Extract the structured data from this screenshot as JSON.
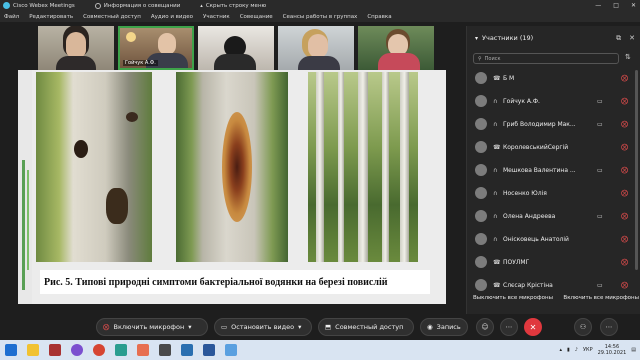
{
  "window": {
    "app_title": "Cisco Webex Meetings",
    "info_label": "Информация о совещании",
    "hide_menu_label": "Скрыть строку меню",
    "controls": [
      "—",
      "□",
      "✕"
    ]
  },
  "menu": [
    "Файл",
    "Редактировать",
    "Совместный доступ",
    "Аудио и видео",
    "Участник",
    "Совещание",
    "Сеансы работы в группах",
    "Справка"
  ],
  "video_tiles": [
    {
      "label": ""
    },
    {
      "label": "Гойчук А.Ф."
    },
    {
      "label": ""
    },
    {
      "label": ""
    },
    {
      "label": ""
    }
  ],
  "slide": {
    "caption": "Рис. 5. Типові природні симптоми бактеріальної водянки на березі повислій"
  },
  "participants": {
    "title": "Участники (19)",
    "search_placeholder": "Поиск",
    "items": [
      {
        "name": "Б М",
        "device": "phone"
      },
      {
        "name": "Гойчук А.Ф.",
        "device": "headset",
        "cam": true
      },
      {
        "name": "Гриб Володимир Мак...",
        "device": "headset",
        "cam": true
      },
      {
        "name": "КоролевськийСергій",
        "device": "phone"
      },
      {
        "name": "Мешкова Валентина ...",
        "device": "headset",
        "cam": true
      },
      {
        "name": "Носенко Юлія",
        "device": "headset"
      },
      {
        "name": "Олена Андреева",
        "device": "headset",
        "cam": true
      },
      {
        "name": "Онісковець Анатолій",
        "device": "headset"
      },
      {
        "name": "ПОУЛМГ",
        "device": "phone"
      },
      {
        "name": "Слєсар Крістіна",
        "device": "phone",
        "cam": true
      }
    ],
    "mute_all": "Выключить все микрофоны",
    "unmute_all": "Включить все микрофоны"
  },
  "toolbar": {
    "mic_label": "Включить микрофон",
    "video_label": "Остановить видео",
    "share_label": "Совместный доступ",
    "record_label": "Запись"
  },
  "taskbar": {
    "time": "14:56",
    "date": "29.10.2021",
    "lang": "УКР"
  },
  "colors": {
    "accent_green": "#3ea34a",
    "leave_red": "#e0383e",
    "mic_red": "#e34d4d"
  }
}
